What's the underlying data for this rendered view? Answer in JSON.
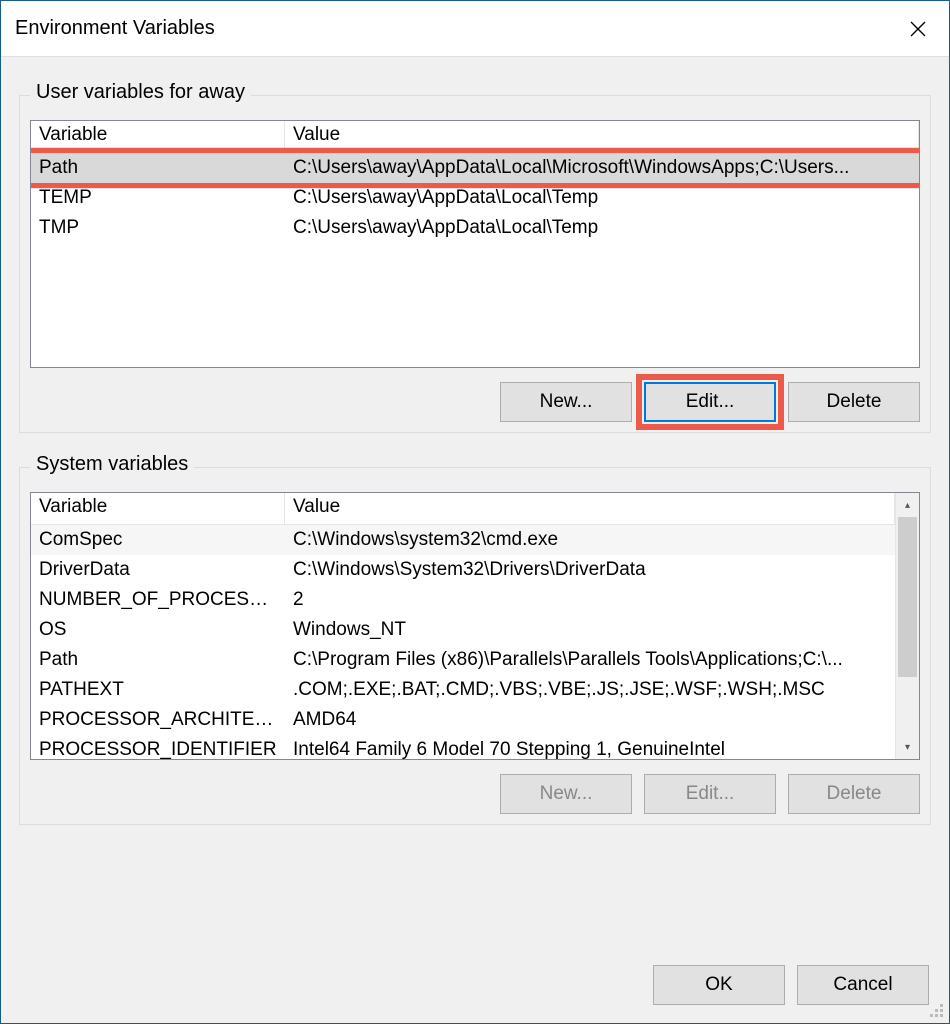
{
  "window": {
    "title": "Environment Variables"
  },
  "user_section": {
    "label": "User variables for away",
    "columns": {
      "var": "Variable",
      "val": "Value"
    },
    "rows": [
      {
        "var": "Path",
        "val": "C:\\Users\\away\\AppData\\Local\\Microsoft\\WindowsApps;C:\\Users...",
        "selected": true,
        "highlighted": true
      },
      {
        "var": "TEMP",
        "val": "C:\\Users\\away\\AppData\\Local\\Temp"
      },
      {
        "var": "TMP",
        "val": "C:\\Users\\away\\AppData\\Local\\Temp"
      }
    ],
    "buttons": {
      "new": "New...",
      "edit": "Edit...",
      "delete": "Delete"
    }
  },
  "system_section": {
    "label": "System variables",
    "columns": {
      "var": "Variable",
      "val": "Value"
    },
    "rows": [
      {
        "var": "ComSpec",
        "val": "C:\\Windows\\system32\\cmd.exe"
      },
      {
        "var": "DriverData",
        "val": "C:\\Windows\\System32\\Drivers\\DriverData"
      },
      {
        "var": "NUMBER_OF_PROCESSORS",
        "val": "2"
      },
      {
        "var": "OS",
        "val": "Windows_NT"
      },
      {
        "var": "Path",
        "val": "C:\\Program Files (x86)\\Parallels\\Parallels Tools\\Applications;C:\\..."
      },
      {
        "var": "PATHEXT",
        "val": ".COM;.EXE;.BAT;.CMD;.VBS;.VBE;.JS;.JSE;.WSF;.WSH;.MSC"
      },
      {
        "var": "PROCESSOR_ARCHITECTURE",
        "val": "AMD64"
      },
      {
        "var": "PROCESSOR_IDENTIFIER",
        "val": "Intel64 Family 6 Model 70 Stepping 1, GenuineIntel"
      }
    ],
    "buttons": {
      "new": "New...",
      "edit": "Edit...",
      "delete": "Delete"
    }
  },
  "footer": {
    "ok": "OK",
    "cancel": "Cancel"
  }
}
